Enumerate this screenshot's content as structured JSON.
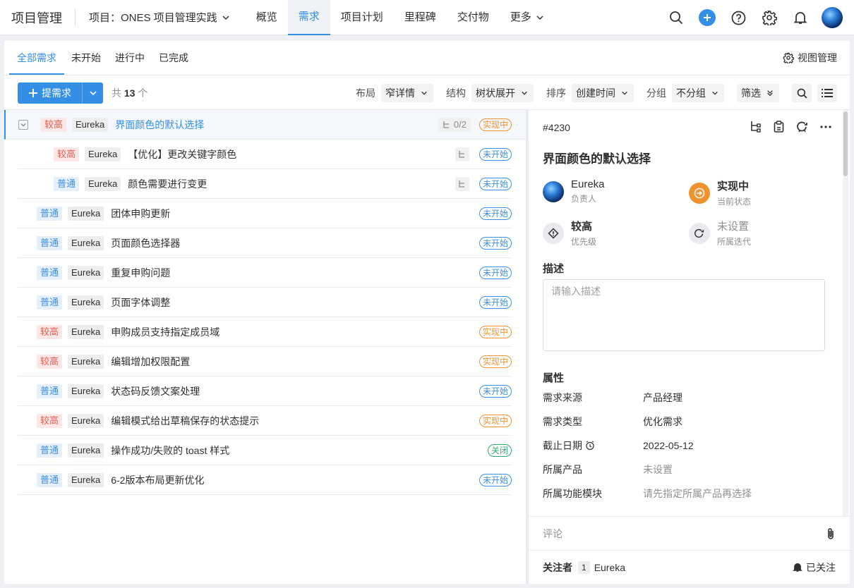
{
  "topbar": {
    "app_title": "项目管理",
    "project": "项目：ONES 项目管理实践",
    "nav": [
      {
        "label": "概览"
      },
      {
        "label": "需求"
      },
      {
        "label": "项目计划"
      },
      {
        "label": "里程碑"
      },
      {
        "label": "交付物"
      },
      {
        "label": "更多"
      }
    ],
    "active_nav": "需求"
  },
  "subtabs": [
    {
      "label": "全部需求"
    },
    {
      "label": "未开始"
    },
    {
      "label": "进行中"
    },
    {
      "label": "已完成"
    }
  ],
  "view_manage": "视图管理",
  "toolbar": {
    "create_label": "提需求",
    "count_prefix": "共",
    "count": "13",
    "count_suffix": "个",
    "layout_label": "布局",
    "layout_value": "窄详情",
    "structure_label": "结构",
    "structure_value": "树状展开",
    "sort_label": "排序",
    "sort_value": "创建时间",
    "group_label": "分组",
    "group_value": "不分组",
    "filter_label": "筛选"
  },
  "rows": [
    {
      "priority": "较高",
      "owner": "Eureka",
      "title": "界面颜色的默认选择",
      "status": "实现中",
      "subcount": "0/2"
    },
    {
      "priority": "较高",
      "owner": "Eureka",
      "title": "【优化】更改关键字颜色",
      "status": "未开始"
    },
    {
      "priority": "普通",
      "owner": "Eureka",
      "title": "颜色需要进行变更",
      "status": "未开始"
    },
    {
      "priority": "普通",
      "owner": "Eureka",
      "title": "团体申购更新",
      "status": "未开始"
    },
    {
      "priority": "普通",
      "owner": "Eureka",
      "title": "页面颜色选择器",
      "status": "未开始"
    },
    {
      "priority": "普通",
      "owner": "Eureka",
      "title": "重复申购问题",
      "status": "未开始"
    },
    {
      "priority": "普通",
      "owner": "Eureka",
      "title": "页面字体调整",
      "status": "未开始"
    },
    {
      "priority": "较高",
      "owner": "Eureka",
      "title": "申购成员支持指定成员域",
      "status": "实现中"
    },
    {
      "priority": "较高",
      "owner": "Eureka",
      "title": "编辑增加权限配置",
      "status": "实现中"
    },
    {
      "priority": "普通",
      "owner": "Eureka",
      "title": "状态码反馈文案处理",
      "status": "未开始"
    },
    {
      "priority": "较高",
      "owner": "Eureka",
      "title": "编辑模式给出草稿保存的状态提示",
      "status": "实现中"
    },
    {
      "priority": "普通",
      "owner": "Eureka",
      "title": "操作成功/失败的 toast 样式",
      "status": "关闭"
    },
    {
      "priority": "普通",
      "owner": "Eureka",
      "title": "6-2版本布局更新优化",
      "status": "未开始"
    }
  ],
  "detail": {
    "id": "#4230",
    "title": "界面颜色的默认选择",
    "assignee": "Eureka",
    "assignee_label": "负责人",
    "status": "实现中",
    "status_label": "当前状态",
    "priority": "较高",
    "priority_label": "优先级",
    "sprint": "未设置",
    "sprint_label": "所属迭代",
    "desc_heading": "描述",
    "desc_placeholder": "请输入描述",
    "props_heading": "属性",
    "props": [
      {
        "key": "需求来源",
        "value": "产品经理"
      },
      {
        "key": "需求类型",
        "value": "优化需求"
      },
      {
        "key": "截止日期",
        "value": "2022-05-12"
      },
      {
        "key": "所属产品",
        "value": "未设置"
      },
      {
        "key": "所属功能模块",
        "value": "请先指定所属产品再选择"
      }
    ],
    "comment_placeholder": "评论",
    "followers_label": "关注者",
    "followers_count": "1",
    "follower_name": "Eureka",
    "follow_button": "已关注"
  },
  "colors": {
    "accent": "#338fe5",
    "high": "#e65b4a",
    "in_progress": "#f0922e",
    "todo": "#3d8fe0",
    "closed": "#2dab6d"
  }
}
